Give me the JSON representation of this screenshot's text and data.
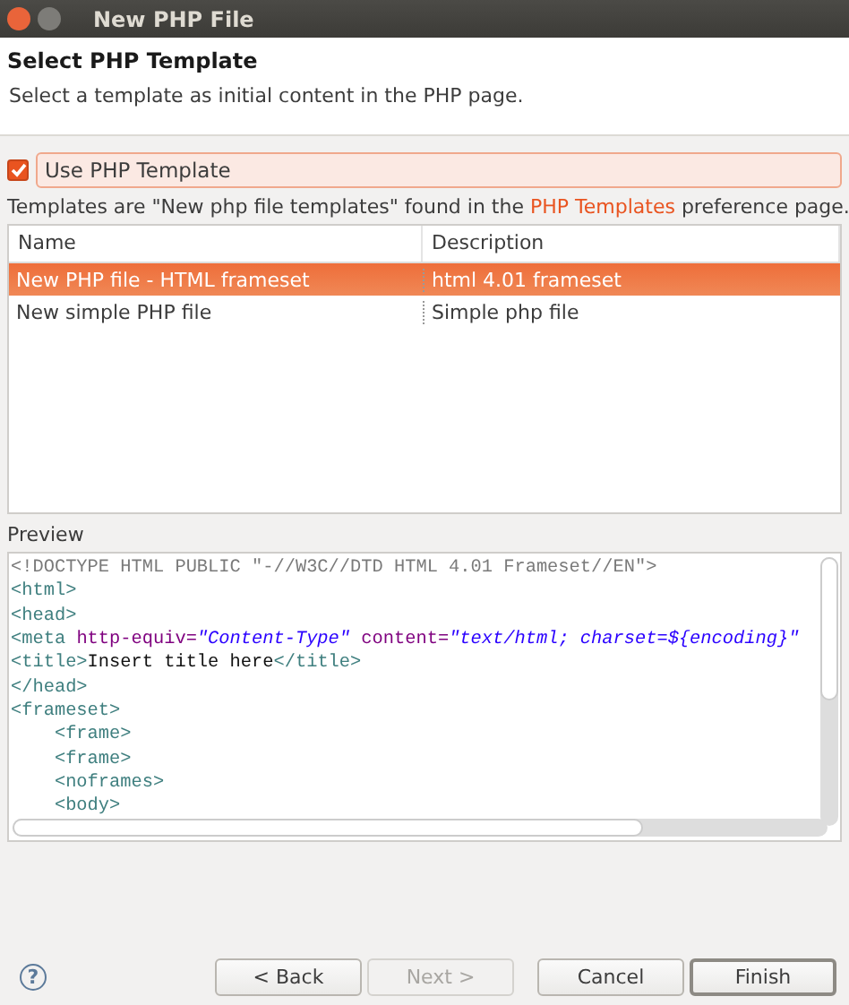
{
  "window": {
    "title": "New PHP File"
  },
  "header": {
    "title": "Select PHP Template",
    "description": "Select a template as initial content in the PHP page."
  },
  "use_template": {
    "label": "Use PHP Template",
    "checked": true
  },
  "info": {
    "before": "Templates are \"New php file templates\" found in the ",
    "link": "PHP Templates",
    "after": " preference page."
  },
  "table": {
    "columns": [
      "Name",
      "Description"
    ],
    "rows": [
      {
        "cells": [
          "New PHP file - HTML frameset",
          "html 4.01 frameset"
        ],
        "selected": true
      },
      {
        "cells": [
          "New simple PHP file",
          "Simple php file"
        ],
        "selected": false
      }
    ]
  },
  "preview": {
    "label": "Preview",
    "lines": [
      [
        {
          "kind": "doctype",
          "text": "<!DOCTYPE HTML PUBLIC \"-//W3C//DTD HTML 4.01 Frameset//EN\">"
        }
      ],
      [
        {
          "kind": "tag",
          "text": "<html>"
        }
      ],
      [
        {
          "kind": "tag",
          "text": "<head>"
        }
      ],
      [
        {
          "kind": "tag",
          "text": "<meta "
        },
        {
          "kind": "attr",
          "text": "http-equiv="
        },
        {
          "kind": "value",
          "text": "\"Content-Type\""
        },
        {
          "kind": "attr",
          "text": " content="
        },
        {
          "kind": "value",
          "text": "\"text/html; charset=${encoding}\""
        }
      ],
      [
        {
          "kind": "tag",
          "text": "<title>"
        },
        {
          "kind": "text",
          "text": "Insert title here"
        },
        {
          "kind": "tag",
          "text": "</title>"
        }
      ],
      [
        {
          "kind": "tag",
          "text": "</head>"
        }
      ],
      [
        {
          "kind": "tag",
          "text": "<frameset>"
        }
      ],
      [
        {
          "kind": "tag",
          "text": "    <frame>"
        }
      ],
      [
        {
          "kind": "tag",
          "text": "    <frame>"
        }
      ],
      [
        {
          "kind": "tag",
          "text": "    <noframes>"
        }
      ],
      [
        {
          "kind": "tag",
          "text": "    <body>"
        }
      ]
    ]
  },
  "help": "?",
  "buttons": [
    {
      "label": "< Back",
      "disabled": false,
      "default": false
    },
    {
      "label": "Next >",
      "disabled": true,
      "default": false
    },
    {
      "label": "Cancel",
      "disabled": false,
      "default": false
    },
    {
      "label": "Finish",
      "disabled": false,
      "default": true
    }
  ]
}
